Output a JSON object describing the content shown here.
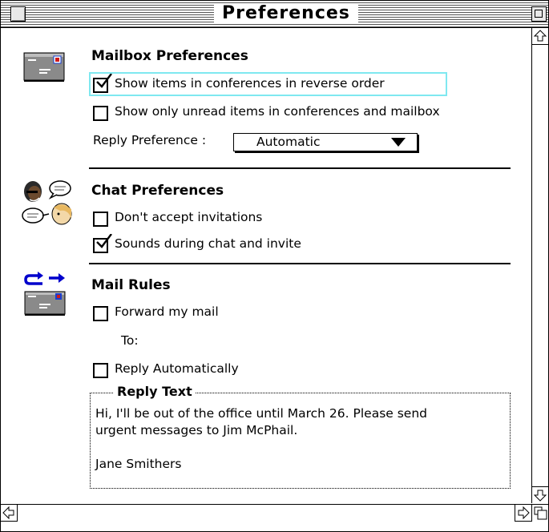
{
  "window": {
    "title": "Preferences"
  },
  "mailbox": {
    "title": "Mailbox Preferences",
    "reverse_order_label": "Show items in conferences in reverse order",
    "reverse_order_checked": true,
    "unread_only_label": "Show only unread items in conferences and mailbox",
    "unread_only_checked": false,
    "reply_pref_label": "Reply Preference :",
    "reply_pref_value": "Automatic"
  },
  "chat": {
    "title": "Chat Preferences",
    "no_invites_label": "Don't accept invitations",
    "no_invites_checked": false,
    "sounds_label": "Sounds during chat and invite",
    "sounds_checked": true
  },
  "rules": {
    "title": "Mail Rules",
    "forward_label": "Forward my mail",
    "forward_checked": false,
    "to_label": "To:",
    "reply_auto_label": "Reply Automatically",
    "reply_auto_checked": false,
    "reply_text_legend": "Reply Text",
    "reply_text_line1": "Hi, I'll be out of the office until March 26. Please send",
    "reply_text_line2": "urgent messages to Jim McPhail.",
    "reply_text_signature": "Jane Smithers"
  },
  "icons": {
    "mailbox": "mail-envelope-icon",
    "chat": "chat-faces-icon",
    "rules": "forward-mail-icon",
    "scroll_up": "arrow-up-icon",
    "scroll_down": "arrow-down-icon",
    "scroll_left": "arrow-left-icon",
    "scroll_right": "arrow-right-icon"
  },
  "colors": {
    "focus_ring": "#7fe8f0",
    "arrow_blue": "#0000cc",
    "stamp_blue": "#1a3fd0",
    "stamp_red": "#d01a1a",
    "envelope_gray": "#8a8a8a"
  }
}
